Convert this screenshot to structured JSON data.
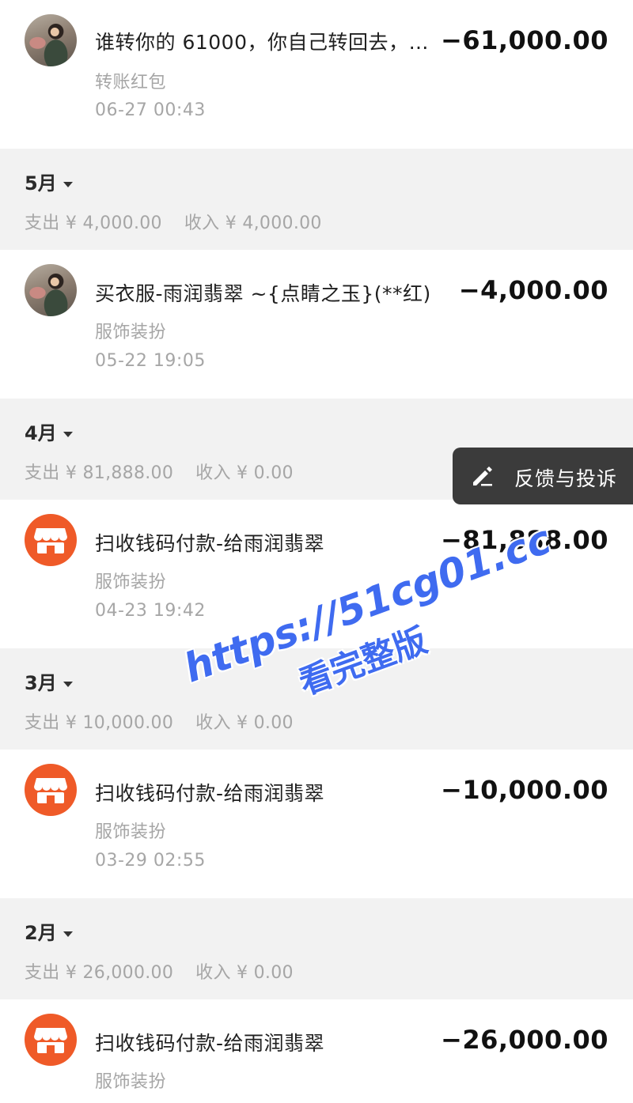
{
  "transactions": [
    {
      "title": "谁转你的 61000，你自己转回去，…",
      "category": "转账红包",
      "datetime": "06-27  00:43",
      "amount": "−61,000.00",
      "icon": "user-photo-avatar"
    },
    {
      "title": "买衣服-雨润翡翠 ~{点睛之玉}(**红)",
      "category": "服饰装扮",
      "datetime": "05-22  19:05",
      "amount": "−4,000.00",
      "icon": "user-photo-avatar"
    },
    {
      "title": "扫收钱码付款-给雨润翡翠",
      "category": "服饰装扮",
      "datetime": "04-23  19:42",
      "amount": "−81,888.00",
      "icon": "shop-icon"
    },
    {
      "title": "扫收钱码付款-给雨润翡翠",
      "category": "服饰装扮",
      "datetime": "03-29  02:55",
      "amount": "−10,000.00",
      "icon": "shop-icon"
    },
    {
      "title": "扫收钱码付款-给雨润翡翠",
      "category": "服饰装扮",
      "datetime": "",
      "amount": "−26,000.00",
      "icon": "shop-icon"
    }
  ],
  "months": [
    {
      "label": "5月",
      "expense": "支出 ¥ 4,000.00",
      "income": "收入 ¥ 4,000.00"
    },
    {
      "label": "4月",
      "expense": "支出 ¥ 81,888.00",
      "income": "收入 ¥ 0.00"
    },
    {
      "label": "3月",
      "expense": "支出 ¥ 10,000.00",
      "income": "收入 ¥ 0.00"
    },
    {
      "label": "2月",
      "expense": "支出 ¥ 26,000.00",
      "income": "收入 ¥ 0.00"
    }
  ],
  "feedback": {
    "label": "反馈与投诉",
    "icon": "edit-pen-icon"
  },
  "watermark": {
    "line1": "https://51cg01.cc",
    "line2": "看完整版"
  },
  "colors": {
    "shop": "#ef5a28",
    "header_bg": "#f2f2f2",
    "watermark": "#3f6bf0"
  }
}
